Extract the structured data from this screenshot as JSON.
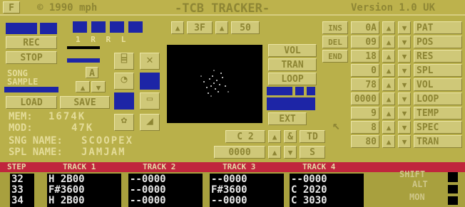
{
  "title_bar": {
    "left_glyph": "F",
    "copyright": "© 1990 mph",
    "title": "-TCB TRACKER-",
    "version": "Version 1.0 UK"
  },
  "left_panel": {
    "rec": "REC",
    "stop": "STOP",
    "channel_labels": "1 R R L",
    "song": "SONG",
    "sample": "SAMPLE",
    "a": "A",
    "load": "LOAD",
    "save": "SAVE",
    "mem_label": "MEM:",
    "mem_value": "1674K",
    "mod_label": "MOD:",
    "mod_value": "47K",
    "sng_label": "SNG NAME:",
    "sng_value": "SCOOPEX",
    "spl_label": "SPL NAME:",
    "spl_value": "JAMJAM"
  },
  "center": {
    "speed_value": "3F",
    "speed2_value": "50",
    "vol": "VOL",
    "tran": "TRAN",
    "loop": "LOOP",
    "ext": "EXT",
    "c2": "C 2",
    "counter": "0000",
    "td": "TD"
  },
  "right_panel": {
    "pat": "PAT",
    "pos": "POS",
    "res": "RES",
    "spl": "SPL",
    "vol": "VOL",
    "loop": "LOOP",
    "temp": "TEMP",
    "spec": "SPEC",
    "tran": "TRAN",
    "ins": "INS",
    "del": "DEL",
    "end": "END",
    "values": [
      "0A",
      "09",
      "18",
      "0",
      "78",
      "0000",
      "9",
      "8",
      "80"
    ]
  },
  "tracks": {
    "headers": [
      "STEP",
      "TRACK 1",
      "TRACK 2",
      "TRACK 3",
      "TRACK 4"
    ],
    "rows": [
      {
        "step": "32",
        "t1": "H 2B00",
        "t2": "--0000",
        "t3": "--0000",
        "t4": "--0000"
      },
      {
        "step": "33",
        "t1": "F#3600",
        "t2": "--0000",
        "t3": "F#3600",
        "t4": "C 2020"
      },
      {
        "step": "34",
        "t1": "H 2B00",
        "t2": "--0000",
        "t3": "--0000",
        "t4": "C 3030"
      }
    ],
    "side": {
      "shift": "SHIFT",
      "alt": "ALT",
      "mon": "MON"
    }
  },
  "colors": {
    "bg": "#b9b04a",
    "blue": "#1d25a6",
    "red": "#c0263d"
  }
}
